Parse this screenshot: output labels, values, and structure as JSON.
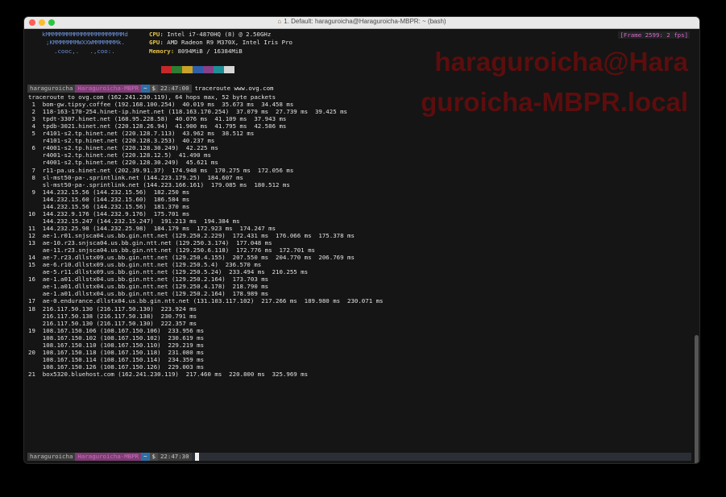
{
  "window": {
    "title": "1. Default: haraguroicha@Haraguroicha-MBPR: ~ (bash)"
  },
  "frame_counter": "[Frame 2599: 2 fps]",
  "sysinfo": {
    "ascii": [
      "kMMMMMMMMMMMMMMMMMMMMMMd",
      ";KMMMMMMMWXXWMMMMMMMk.",
      ".cooc,.   .,coo:."
    ],
    "cpu_label": "CPU:",
    "cpu_value": " Intel i7-4870HQ (8) @ 2.50GHz",
    "gpu_label": "GPU:",
    "gpu_value": " AMD Radeon R9 M370X, Intel Iris Pro",
    "mem_label": "Memory:",
    "mem_value": " 8094MiB / 16384MiB",
    "swatch_colors": [
      "#c62828",
      "#2e7d32",
      "#c9a227",
      "#2f5fa8",
      "#8a3f86",
      "#1f8f96",
      "#d6d6d6"
    ]
  },
  "watermark": {
    "line1": "haraguroicha@Hara",
    "line2": "guroicha-MBPR.local"
  },
  "prompt_top": {
    "user": "haraguroicha",
    "host": "Haraguroicha-MBPR",
    "dir": "~",
    "dollar": "$",
    "time": "22:47:00",
    "command": "traceroute www.ovg.com"
  },
  "prompt_bottom": {
    "user": "haraguroicha",
    "host": "Haraguroicha-MBPR",
    "dir": "~",
    "dollar": "$",
    "time": "22:47:30"
  },
  "output": [
    "traceroute to ovg.com (162.241.230.119), 64 hops max, 52 byte packets",
    " 1  bom-gw.tipsy.coffee (192.168.100.254)  40.019 ms  35.673 ms  34.458 ms",
    " 2  118-163-170-254.hinet-ip.hinet.net (118.163.170.254)  37.079 ms  27.739 ms  39.425 ms",
    " 3  tpdt-3307.hinet.net (168.95.228.58)  40.076 ms  41.109 ms  37.943 ms",
    " 4  tpdb-3021.hinet.net (220.128.26.94)  41.900 ms  41.795 ms  42.586 ms",
    " 5  r4101-s2.tp.hinet.net (220.128.7.113)  43.962 ms  38.512 ms",
    "    r4101-s2.tp.hinet.net (220.128.3.253)  40.237 ms",
    " 6  r4001-s2.tp.hinet.net (220.128.30.249)  42.225 ms",
    "    r4001-s2.tp.hinet.net (220.128.12.5)  41.490 ms",
    "    r4001-s2.tp.hinet.net (220.128.30.249)  45.621 ms",
    " 7  r11-pa.us.hinet.net (202.39.91.37)  174.948 ms  170.275 ms  172.056 ms",
    " 8  sl-mst50-pa-.sprintlink.net (144.223.179.25)  184.607 ms",
    "    sl-mst50-pa-.sprintlink.net (144.223.166.161)  179.085 ms  180.512 ms",
    " 9  144.232.15.56 (144.232.15.56)  182.250 ms",
    "    144.232.15.60 (144.232.15.60)  186.584 ms",
    "    144.232.15.56 (144.232.15.56)  181.370 ms",
    "10  144.232.9.176 (144.232.9.176)  175.701 ms",
    "    144.232.15.247 (144.232.15.247)  191.213 ms  194.384 ms",
    "11  144.232.25.98 (144.232.25.98)  184.179 ms  172.923 ms  174.247 ms",
    "12  ae-1.r01.snjsca04.us.bb.gin.ntt.net (129.250.2.229)  172.431 ms  176.066 ms  175.378 ms",
    "13  ae-10.r23.snjsca04.us.bb.gin.ntt.net (129.250.3.174)  177.048 ms",
    "    ae-11.r23.snjsca04.us.bb.gin.ntt.net (129.250.6.118)  172.776 ms  172.701 ms",
    "14  ae-7.r23.dllstx09.us.bb.gin.ntt.net (129.250.4.155)  207.550 ms  204.770 ms  206.769 ms",
    "15  ae-6.r10.dllstx09.us.bb.gin.ntt.net (129.250.5.4)  236.570 ms",
    "    ae-5.r11.dllstx09.us.bb.gin.ntt.net (129.250.5.24)  233.494 ms  210.255 ms",
    "16  ae-1.a01.dllstx04.us.bb.gin.ntt.net (129.250.2.164)  173.703 ms",
    "    ae-1.a01.dllstx04.us.bb.gin.ntt.net (129.250.4.178)  218.790 ms",
    "    ae-1.a01.dllstx04.us.bb.gin.ntt.net (129.250.2.164)  178.989 ms",
    "17  ae-0.endurance.dllstx04.us.bb.gin.ntt.net (131.103.117.102)  217.266 ms  189.980 ms  230.071 ms",
    "18  216.117.50.130 (216.117.50.130)  223.924 ms",
    "    216.117.50.138 (216.117.50.138)  230.791 ms",
    "    216.117.50.130 (216.117.50.130)  222.357 ms",
    "19  108.167.150.106 (108.167.150.106)  233.956 ms",
    "    108.167.150.102 (108.167.150.102)  230.619 ms",
    "    108.167.150.110 (108.167.150.110)  229.219 ms",
    "20  108.167.150.118 (108.167.150.118)  231.080 ms",
    "    108.167.150.114 (108.167.150.114)  234.359 ms",
    "    108.167.150.126 (108.167.150.126)  229.003 ms",
    "21  box5320.bluehost.com (162.241.230.119)  217.460 ms  220.800 ms  325.969 ms"
  ]
}
